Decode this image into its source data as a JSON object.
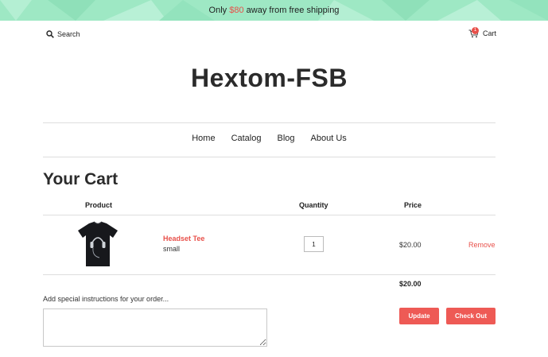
{
  "announcement": {
    "prefix": "Only ",
    "amount": "$80",
    "suffix": " away from free shipping",
    "amount_color": "#e8504a",
    "bar_color": "#9ee8c4"
  },
  "header": {
    "search_label": "Search",
    "cart_label": "Cart",
    "cart_count": "1"
  },
  "site_title": "Hextom-FSB",
  "nav": {
    "items": [
      {
        "label": "Home"
      },
      {
        "label": "Catalog"
      },
      {
        "label": "Blog"
      },
      {
        "label": "About Us"
      }
    ]
  },
  "cart": {
    "heading": "Your Cart",
    "columns": {
      "product": "Product",
      "quantity": "Quantity",
      "price": "Price"
    },
    "items": [
      {
        "name": "Headset Tee",
        "variant": "small",
        "quantity": "1",
        "price": "$20.00",
        "remove_label": "Remove"
      }
    ],
    "subtotal": "$20.00",
    "instructions_label": "Add special instructions for your order...",
    "update_label": "Update",
    "checkout_label": "Check Out",
    "accent_color": "#ee5a55"
  }
}
